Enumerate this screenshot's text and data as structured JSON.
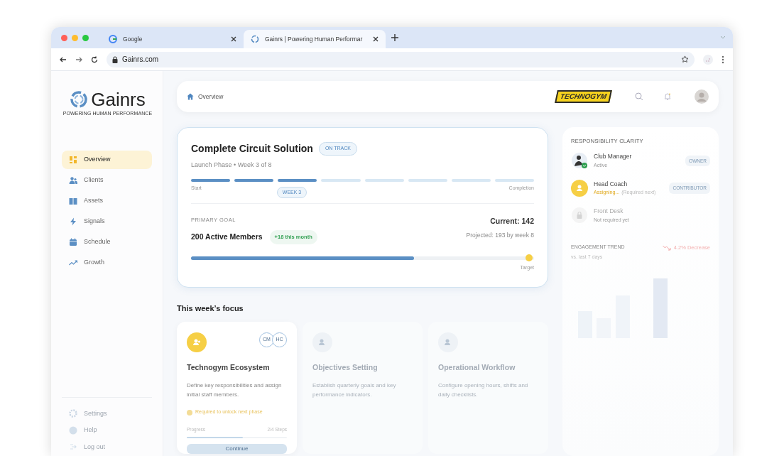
{
  "browser": {
    "tabs": [
      {
        "title": "Google",
        "selected": false
      },
      {
        "title": "Gainrs | Powering Human Performar",
        "selected": true
      }
    ],
    "url": "Gainrs.com"
  },
  "sidebar": {
    "brand": "Gainrs",
    "tagline": "POWERING HUMAN PERFORMANCE",
    "items": [
      {
        "label": "Overview",
        "selected": true
      },
      {
        "label": "Clients",
        "selected": false
      },
      {
        "label": "Assets",
        "selected": false
      },
      {
        "label": "Signals",
        "selected": false
      },
      {
        "label": "Schedule",
        "selected": false
      },
      {
        "label": "Growth",
        "selected": false
      }
    ],
    "footer_items": [
      {
        "label": "Settings"
      },
      {
        "label": "Help"
      },
      {
        "label": "Log out"
      }
    ]
  },
  "header": {
    "breadcrumb": "Overview",
    "partner_logo": "TECHNOGYM"
  },
  "phase_card": {
    "title": "Complete Circuit Solution",
    "badge": "ON TRACK",
    "subtitle": "Launch Phase • Week 3 of 8",
    "segments": [
      {
        "done": true
      },
      {
        "done": true
      },
      {
        "done": true
      },
      {
        "done": false
      },
      {
        "done": false
      },
      {
        "done": false
      },
      {
        "done": false
      },
      {
        "done": false
      }
    ],
    "start_label": "Start",
    "end_label": "Completion",
    "week_badge": "WEEK 3",
    "goal_label": "PRIMARY GOAL",
    "goal": "200 Active Members",
    "goal_delta": "+18 this month",
    "current": "Current: 142",
    "projected": "Projected: 193 by week 8",
    "level": 0.65,
    "target_label": "Target"
  },
  "focus": {
    "heading": "This week’s focus",
    "cards": [
      {
        "title": "Technogym Ecosystem",
        "description": "Define key responsibilities and assign initial staff members.",
        "disabled": false,
        "avatars": [
          "CM",
          "HC"
        ],
        "note": "Required to unlock next phase",
        "progress_label": "Progress",
        "progress_steps": "2/4 Steps",
        "level": 0.56,
        "button": "Continue"
      },
      {
        "title": "Objectives Setting",
        "description": "Establish quarterly goals and key performance indicators.",
        "disabled": true
      },
      {
        "title": "Operational Workflow",
        "description": "Configure opening hours, shifts and daily checklists.",
        "disabled": true
      }
    ]
  },
  "responsibility": {
    "title": "RESPONSIBILITY CLARITY",
    "rows": [
      {
        "kind": "person",
        "name": "Club Manager",
        "status": "Active",
        "badge": "OWNER",
        "disabled": false
      },
      {
        "kind": "pending",
        "name": "Head Coach",
        "status": "Assigning...",
        "status_note": "(Required next)",
        "badge": "CONTRIBUTOR",
        "disabled": false
      },
      {
        "kind": "locked",
        "name": "Front Desk",
        "status": "Not required yet",
        "disabled": true
      }
    ]
  },
  "engagement": {
    "title": "ENGAGEMENT TREND",
    "delta": "4.2% Decrease",
    "subtitle": "vs. last 7 days"
  }
}
